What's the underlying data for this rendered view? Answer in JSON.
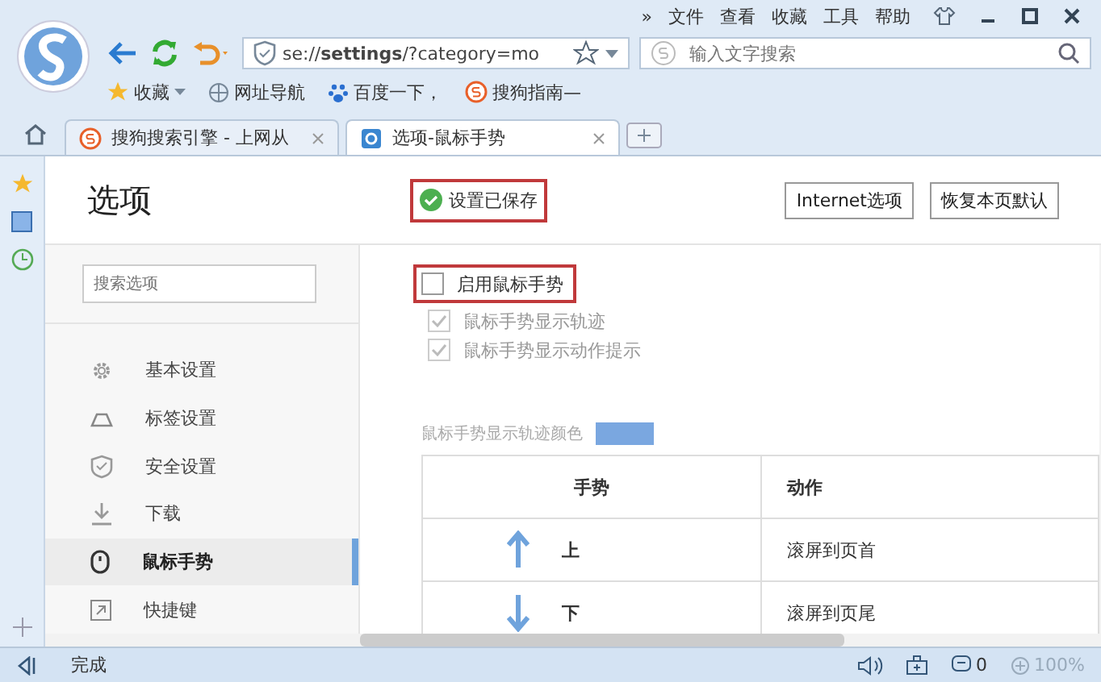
{
  "menu_more": "»",
  "menu": [
    "文件",
    "查看",
    "收藏",
    "工具",
    "帮助"
  ],
  "address": {
    "prefix": "se://",
    "bold": "settings",
    "suffix": "/?category=mo"
  },
  "search": {
    "placeholder": "输入文字搜索"
  },
  "bookmarks": [
    {
      "kind": "star",
      "label": "收藏"
    },
    {
      "kind": "globe",
      "label": "网址导航"
    },
    {
      "kind": "paw",
      "label": "百度一下，"
    },
    {
      "kind": "sogou",
      "label": "搜狗指南—"
    }
  ],
  "tabs": [
    {
      "kind": "sogou",
      "label": "搜狗搜索引擎 - 上网从",
      "selected": false
    },
    {
      "kind": "gear",
      "label": "选项-鼠标手势",
      "selected": true
    }
  ],
  "page": {
    "title": "选项",
    "saved": {
      "label": "设置已保存",
      "highlighted": true
    },
    "buttons": [
      "Internet选项",
      "恢复本页默认"
    ]
  },
  "nav_search": {
    "placeholder": "搜索选项"
  },
  "nav": [
    {
      "kind": "gear",
      "label": "基本设置",
      "selected": false
    },
    {
      "kind": "tab",
      "label": "标签设置",
      "selected": false
    },
    {
      "kind": "shield",
      "label": "安全设置",
      "selected": false
    },
    {
      "kind": "download",
      "label": "下载",
      "selected": false
    },
    {
      "kind": "mouse",
      "label": "鼠标手势",
      "selected": true
    },
    {
      "kind": "shortcut",
      "label": "快捷键",
      "selected": false
    }
  ],
  "options": [
    {
      "label": "启用鼠标手势",
      "checked": false,
      "disabled": false,
      "highlighted": true
    },
    {
      "label": "鼠标手势显示轨迹",
      "checked": true,
      "disabled": true,
      "highlighted": false
    },
    {
      "label": "鼠标手势显示动作提示",
      "checked": true,
      "disabled": true,
      "highlighted": false
    }
  ],
  "trail_color": {
    "label": "鼠标手势显示轨迹颜色",
    "color": "#7aa7e0"
  },
  "table": {
    "columns": [
      "手势",
      "动作"
    ],
    "rows": [
      {
        "kind": "up",
        "gesture": "上",
        "action": "滚屏到页首"
      },
      {
        "kind": "down",
        "gesture": "下",
        "action": "滚屏到页尾"
      }
    ]
  },
  "status": {
    "text": "完成",
    "count": "0",
    "zoom": "100%"
  }
}
